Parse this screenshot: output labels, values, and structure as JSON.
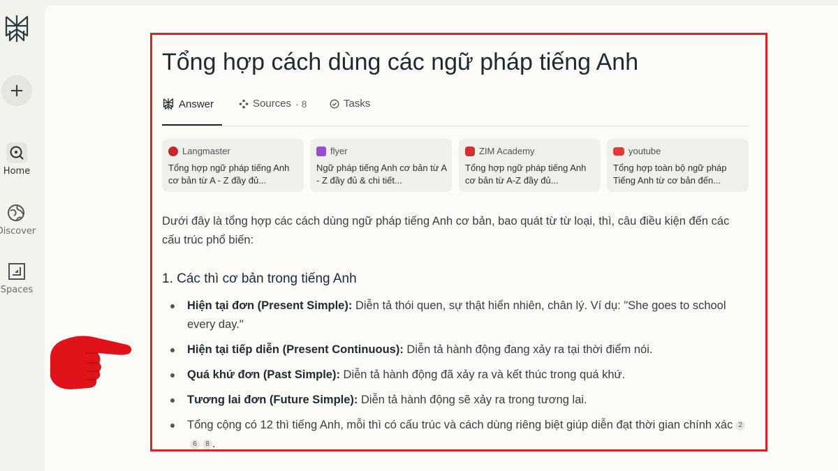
{
  "sidebar": {
    "new_label": "+",
    "nav": [
      {
        "label": "Home"
      },
      {
        "label": "Discover"
      },
      {
        "label": "Spaces"
      }
    ]
  },
  "title": "Tổng hợp cách dùng các ngữ pháp tiếng Anh",
  "tabs": {
    "answer": "Answer",
    "sources": "Sources",
    "sources_count": "· 8",
    "tasks": "Tasks"
  },
  "sources": [
    {
      "name": "Langmaster",
      "title": "Tổng hợp ngữ pháp tiếng Anh cơ bản từ A - Z đầy đủ...",
      "color": "#c62828"
    },
    {
      "name": "flyer",
      "title": "Ngữ pháp tiếng Anh cơ bản từ A - Z đầy đủ & chi tiết...",
      "color": "#9c4dcc"
    },
    {
      "name": "ZIM Academy",
      "title": "Tổng hợp ngữ pháp tiếng Anh cơ bản từ A-Z đầy đủ...",
      "color": "#d32f2f"
    },
    {
      "name": "youtube",
      "title": "Tổng hợp toàn bộ ngữ pháp Tiếng Anh từ cơ bản đến...",
      "color": "#e53935"
    }
  ],
  "intro": "Dưới đây là tổng hợp các cách dùng ngữ pháp tiếng Anh cơ bản, bao quát từ từ loại, thì, câu điều kiện đến các cấu trúc phổ biến:",
  "section1": {
    "heading": "1. Các thì cơ bản trong tiếng Anh",
    "items": [
      {
        "term": "Hiện tại đơn (Present Simple):",
        "text": " Diễn tả thói quen, sự thật hiển nhiên, chân lý. Ví dụ: \"She goes to school every day.\""
      },
      {
        "term": "Hiện tại tiếp diễn (Present Continuous):",
        "text": " Diễn tả hành động đang xảy ra tại thời điểm nói."
      },
      {
        "term": "Quá khứ đơn (Past Simple):",
        "text": " Diễn tả hành động đã xảy ra và kết thúc trong quá khứ."
      },
      {
        "term": "Tương lai đơn (Future Simple):",
        "text": " Diễn tả hành động sẽ xảy ra trong tương lai."
      }
    ],
    "last_item": "Tổng cộng có 12 thì tiếng Anh, mỗi thì có cấu trúc và cách dùng riêng biệt giúp diễn đạt thời gian chính xác",
    "citations": [
      "2",
      "6",
      "8"
    ],
    "last_suffix": "."
  },
  "colors": {
    "highlight_frame": "#d8232a",
    "pointer_hand": "#e0121a"
  }
}
